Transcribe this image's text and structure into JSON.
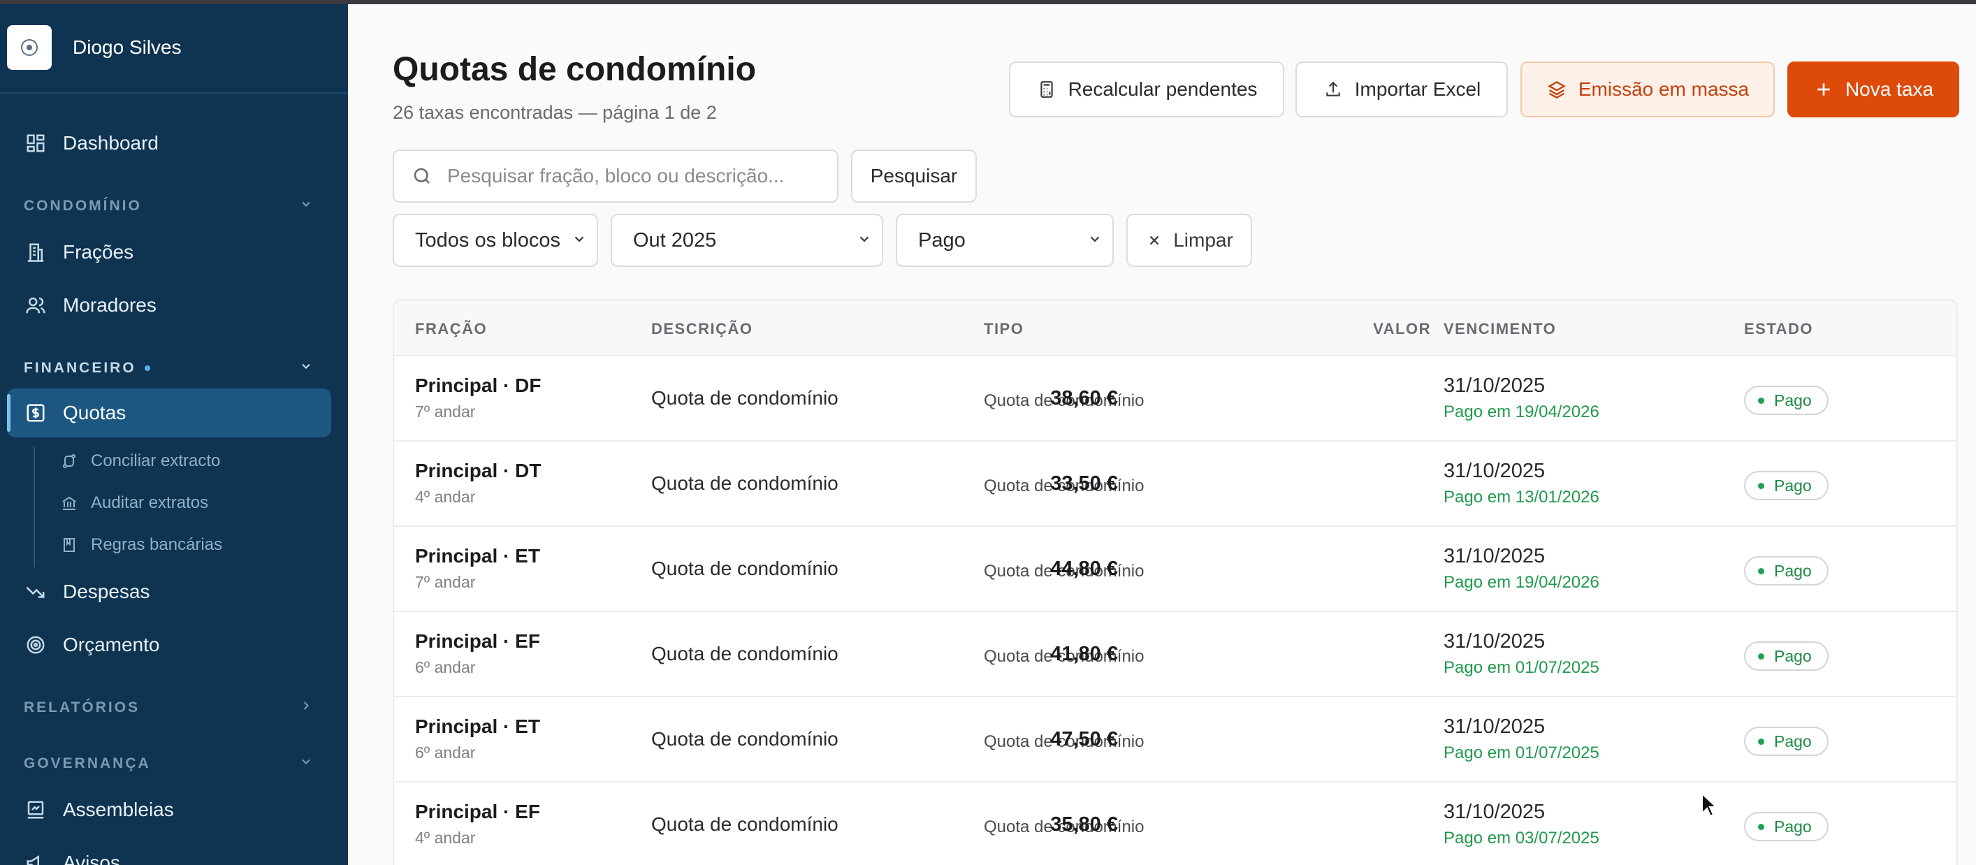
{
  "sidebar": {
    "user_name": "Diogo Silves",
    "nav": {
      "dashboard": "Dashboard",
      "fracoes": "Frações",
      "moradores": "Moradores",
      "quotas": "Quotas",
      "despesas": "Despesas",
      "orcamento": "Orçamento",
      "assembleias": "Assembleias",
      "avisos": "Avisos"
    },
    "sections": {
      "condominio": "CONDOMÍNIO",
      "financeiro": "FINANCEIRO",
      "relatorios": "RELATÓRIOS",
      "governanca": "GOVERNANÇA"
    },
    "sub": {
      "conciliar": "Conciliar extracto",
      "auditar": "Auditar extratos",
      "regras": "Regras bancárias"
    }
  },
  "header": {
    "title": "Quotas de condomínio",
    "subtitle": "26 taxas encontradas — página 1 de 2",
    "buttons": {
      "recalcular": "Recalcular pendentes",
      "importar": "Importar Excel",
      "emissao": "Emissão em massa",
      "nova": "Nova taxa"
    }
  },
  "filters": {
    "search_placeholder": "Pesquisar fração, bloco ou descrição...",
    "search_button": "Pesquisar",
    "bloco": "Todos os blocos",
    "mes": "Out 2025",
    "estado": "Pago",
    "limpar": "Limpar"
  },
  "table": {
    "headers": {
      "fracao": "FRAÇÃO",
      "descricao": "DESCRIÇÃO",
      "tipo": "TIPO",
      "valor": "VALOR",
      "vencimento": "VENCIMENTO",
      "estado": "ESTADO"
    },
    "rows": [
      {
        "fracao": "Principal · DF",
        "andar": "7º andar",
        "descricao": "Quota de condomínio",
        "tipo": "Quota de condomínio",
        "valor": "38,60 €",
        "vencimento": "31/10/2025",
        "pago_em": "Pago em 19/04/2026",
        "estado": "Pago"
      },
      {
        "fracao": "Principal · DT",
        "andar": "4º andar",
        "descricao": "Quota de condomínio",
        "tipo": "Quota de condomínio",
        "valor": "33,50 €",
        "vencimento": "31/10/2025",
        "pago_em": "Pago em 13/01/2026",
        "estado": "Pago"
      },
      {
        "fracao": "Principal · ET",
        "andar": "7º andar",
        "descricao": "Quota de condomínio",
        "tipo": "Quota de condomínio",
        "valor": "44,80 €",
        "vencimento": "31/10/2025",
        "pago_em": "Pago em 19/04/2026",
        "estado": "Pago"
      },
      {
        "fracao": "Principal · EF",
        "andar": "6º andar",
        "descricao": "Quota de condomínio",
        "tipo": "Quota de condomínio",
        "valor": "41,80 €",
        "vencimento": "31/10/2025",
        "pago_em": "Pago em 01/07/2025",
        "estado": "Pago"
      },
      {
        "fracao": "Principal · ET",
        "andar": "6º andar",
        "descricao": "Quota de condomínio",
        "tipo": "Quota de condomínio",
        "valor": "47,50 €",
        "vencimento": "31/10/2025",
        "pago_em": "Pago em 01/07/2025",
        "estado": "Pago"
      },
      {
        "fracao": "Principal · EF",
        "andar": "4º andar",
        "descricao": "Quota de condomínio",
        "tipo": "Quota de condomínio",
        "valor": "35,80 €",
        "vencimento": "31/10/2025",
        "pago_em": "Pago em 03/07/2025",
        "estado": "Pago"
      }
    ]
  },
  "colors": {
    "sidebar_bg": "#0f3452",
    "active_bg": "#1c5781",
    "accent": "#dd4a0a",
    "paid_green": "#1f9a4d"
  }
}
